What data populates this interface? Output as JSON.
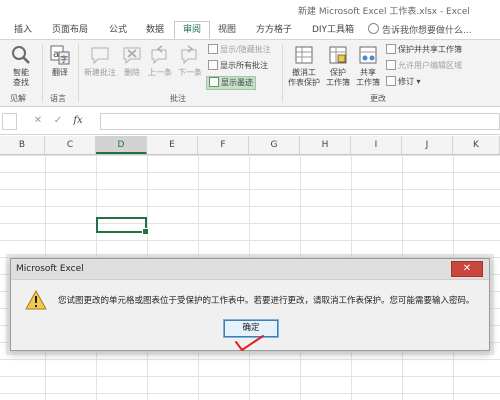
{
  "window": {
    "title": "新建 Microsoft Excel 工作表.xlsx - Excel"
  },
  "ribbon_tabs": [
    {
      "label": "插入",
      "active": false
    },
    {
      "label": "页面布局",
      "active": false
    },
    {
      "label": "公式",
      "active": false
    },
    {
      "label": "数据",
      "active": false
    },
    {
      "label": "审阅",
      "active": true
    },
    {
      "label": "视图",
      "active": false
    },
    {
      "label": "方方格子",
      "active": false
    },
    {
      "label": "DIY工具箱",
      "active": false
    }
  ],
  "tell_me": {
    "label": "告诉我你想要做什么...",
    "icon": "lightbulb-icon"
  },
  "ribbon": {
    "smart_lookup": "智能查找",
    "translate": "翻译",
    "new_comment": "新建批注",
    "delete": "删除",
    "previous": "上一条",
    "next": "下一条",
    "show_hide_comment": "显示/隐藏批注",
    "show_all_comments": "显示所有批注",
    "show_ink": "显示墨迹",
    "unprotect_sheet": "撤消工\n作表保护",
    "protect_workbook": "保护\n工作簿",
    "share_workbook": "共享\n工作簿",
    "protect_and_share": "保护并共享工作簿",
    "allow_edit_ranges": "允许用户编辑区域",
    "track_changes": "修订",
    "groups": {
      "insights": "见解",
      "language": "语言",
      "comments": "批注",
      "changes": "更改"
    }
  },
  "formula_bar": {
    "cancel": "✕",
    "enter": "✓",
    "fx": "fx",
    "value": ""
  },
  "columns": [
    "B",
    "C",
    "D",
    "E",
    "F",
    "G",
    "H",
    "I",
    "J",
    "K"
  ],
  "selected_column": "D",
  "dialog": {
    "title": "Microsoft Excel",
    "close": "✕",
    "message": "您试图更改的单元格或图表位于受保护的工作表中。若要进行更改，请取消工作表保护。您可能需要输入密码。",
    "ok_label": "确定"
  },
  "colors": {
    "accent": "#217346",
    "annotation": "#e02020",
    "close": "#c9463d"
  }
}
